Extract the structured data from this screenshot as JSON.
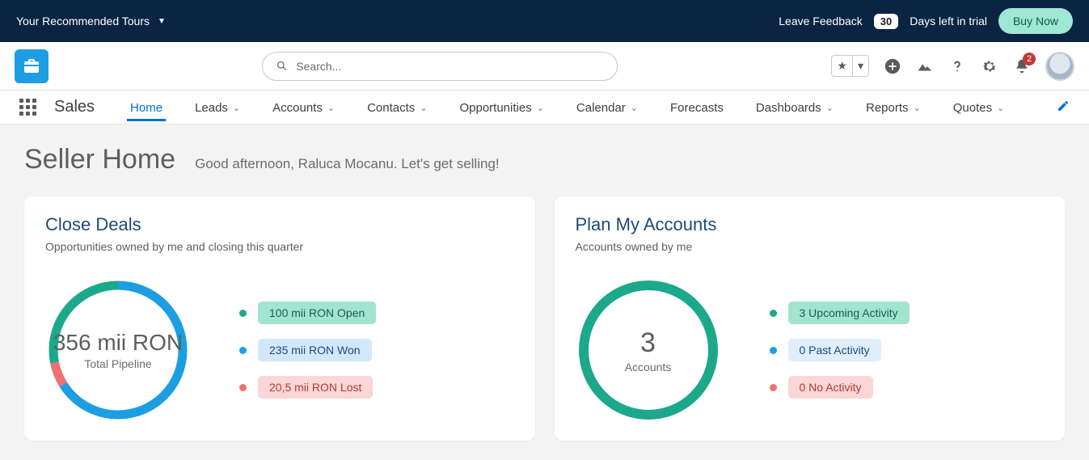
{
  "trial": {
    "tours_label": "Your Recommended Tours",
    "feedback_label": "Leave Feedback",
    "days_left": "30",
    "days_suffix": "Days left in trial",
    "buy_label": "Buy Now"
  },
  "header": {
    "search_placeholder": "Search...",
    "notif_count": "2"
  },
  "nav": {
    "app_name": "Sales",
    "items": [
      {
        "label": "Home",
        "has_chevron": false,
        "active": true
      },
      {
        "label": "Leads",
        "has_chevron": true
      },
      {
        "label": "Accounts",
        "has_chevron": true
      },
      {
        "label": "Contacts",
        "has_chevron": true
      },
      {
        "label": "Opportunities",
        "has_chevron": true
      },
      {
        "label": "Calendar",
        "has_chevron": true
      },
      {
        "label": "Forecasts",
        "has_chevron": false
      },
      {
        "label": "Dashboards",
        "has_chevron": true
      },
      {
        "label": "Reports",
        "has_chevron": true
      },
      {
        "label": "Quotes",
        "has_chevron": true
      }
    ]
  },
  "page": {
    "title": "Seller Home",
    "subtitle": "Good afternoon, Raluca Mocanu. Let's get selling!"
  },
  "card_deals": {
    "title": "Close Deals",
    "subtitle": "Opportunities owned by me and closing this quarter",
    "center_value": "356 mii RON",
    "center_label": "Total Pipeline",
    "legend": [
      {
        "color": "green",
        "label": "100 mii RON Open"
      },
      {
        "color": "blue",
        "label": "235 mii RON Won"
      },
      {
        "color": "red",
        "label": "20,5 mii RON Lost"
      }
    ]
  },
  "card_accounts": {
    "title": "Plan My Accounts",
    "subtitle": "Accounts owned by me",
    "center_value": "3",
    "center_label": "Accounts",
    "legend": [
      {
        "color": "green",
        "pill": "green",
        "label": "3 Upcoming Activity"
      },
      {
        "color": "blue",
        "pill": "lblue",
        "label": "0 Past Activity"
      },
      {
        "color": "red",
        "pill": "red",
        "label": "0 No Activity"
      }
    ]
  },
  "chart_data": [
    {
      "type": "pie",
      "title": "Close Deals — Total Pipeline",
      "total_label": "356 mii RON",
      "unit": "mii RON",
      "series": [
        {
          "name": "Open",
          "value": 100,
          "color": "#1ca88a"
        },
        {
          "name": "Won",
          "value": 235,
          "color": "#1e9ee2"
        },
        {
          "name": "Lost",
          "value": 20.5,
          "color": "#ef7070"
        }
      ]
    },
    {
      "type": "pie",
      "title": "Plan My Accounts",
      "total_label": "3 Accounts",
      "series": [
        {
          "name": "Upcoming Activity",
          "value": 3,
          "color": "#1ca88a"
        },
        {
          "name": "Past Activity",
          "value": 0,
          "color": "#1e9ee2"
        },
        {
          "name": "No Activity",
          "value": 0,
          "color": "#ef7070"
        }
      ]
    }
  ]
}
